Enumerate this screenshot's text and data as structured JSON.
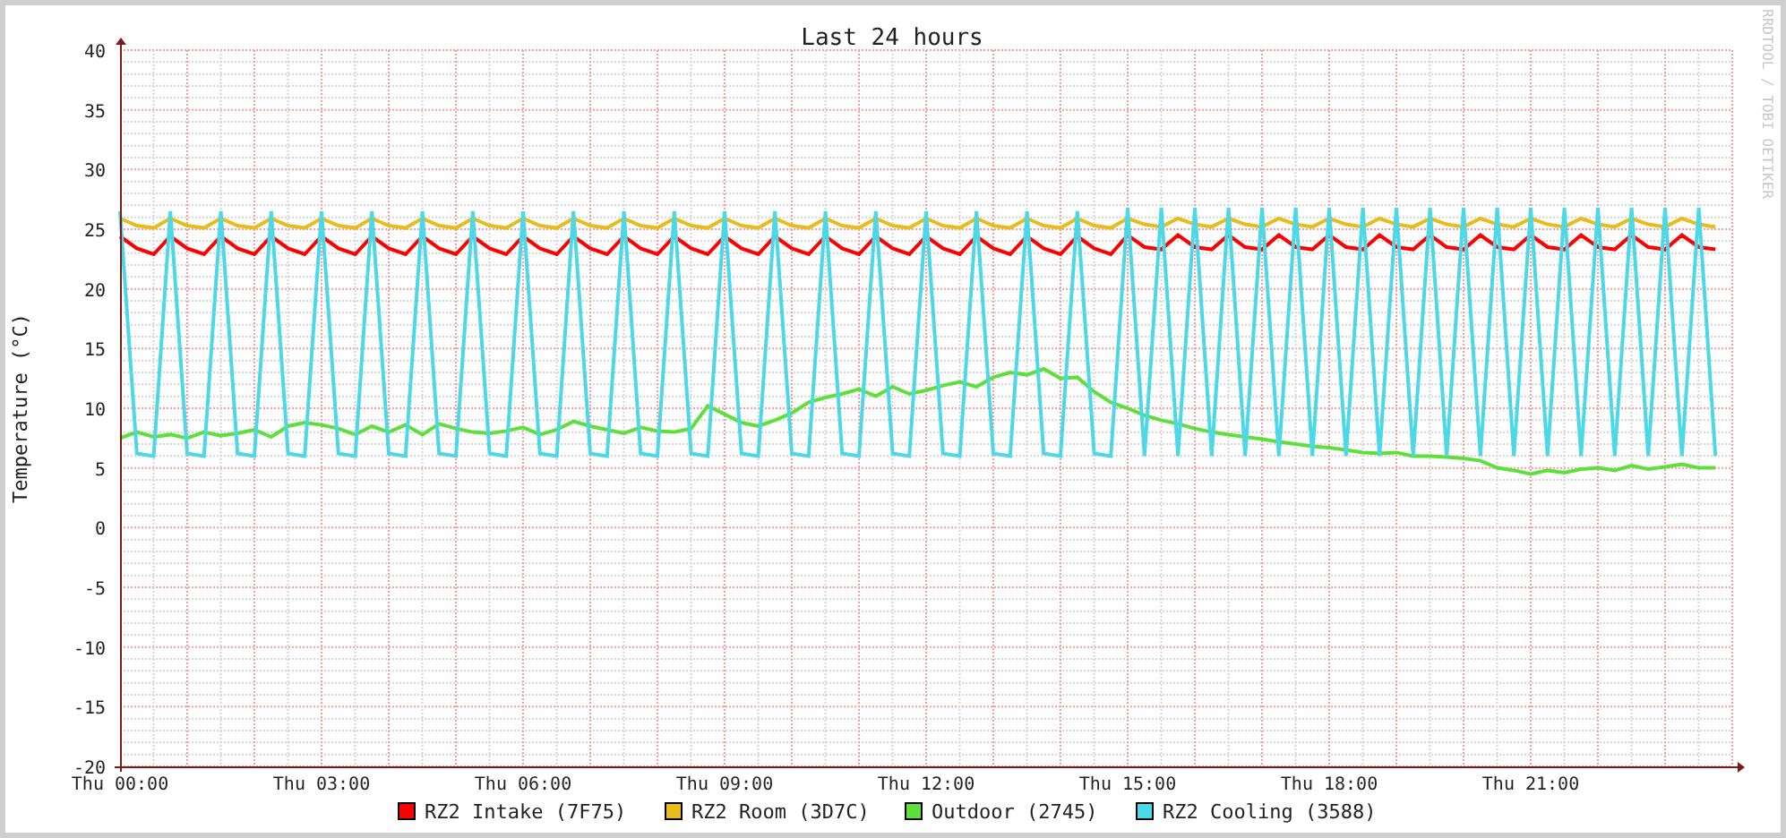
{
  "chart_data": {
    "type": "line",
    "grid": true,
    "legend": "bottom",
    "title": "Last 24 hours",
    "ylabel": "Temperature (°C)",
    "ylim": [
      -20,
      40
    ],
    "categories": [
      "Thu 00:00",
      null,
      null,
      null,
      null,
      null,
      null,
      null,
      null,
      null,
      null,
      null,
      "Thu 03:00",
      null,
      null,
      null,
      null,
      null,
      null,
      null,
      null,
      null,
      null,
      null,
      "Thu 06:00",
      null,
      null,
      null,
      null,
      null,
      null,
      null,
      null,
      null,
      null,
      null,
      "Thu 09:00",
      null,
      null,
      null,
      null,
      null,
      null,
      null,
      null,
      null,
      null,
      null,
      "Thu 12:00",
      null,
      null,
      null,
      null,
      null,
      null,
      null,
      null,
      null,
      null,
      null,
      "Thu 15:00",
      null,
      null,
      null,
      null,
      null,
      null,
      null,
      null,
      null,
      null,
      null,
      "Thu 18:00",
      null,
      null,
      null,
      null,
      null,
      null,
      null,
      null,
      null,
      null,
      null,
      "Thu 21:00",
      null,
      null,
      null,
      null,
      null,
      null,
      null,
      null,
      null,
      null,
      null
    ],
    "yticks": [
      -20,
      -15,
      -10,
      -5,
      0,
      5,
      10,
      15,
      20,
      25,
      30,
      35,
      40
    ],
    "series": [
      {
        "name": "RZ2 Intake (7F75)",
        "color": "#ff0000",
        "values": [
          24.4,
          23.4,
          22.9,
          24.4,
          23.4,
          22.9,
          24.4,
          23.4,
          22.9,
          24.4,
          23.4,
          22.9,
          24.4,
          23.4,
          22.9,
          24.4,
          23.4,
          22.9,
          24.4,
          23.4,
          22.9,
          24.4,
          23.4,
          22.9,
          24.4,
          23.4,
          22.9,
          24.4,
          23.4,
          22.9,
          24.4,
          23.4,
          22.9,
          24.4,
          23.4,
          22.9,
          24.4,
          23.4,
          22.9,
          24.4,
          23.4,
          22.9,
          24.4,
          23.4,
          22.9,
          24.4,
          23.4,
          22.9,
          24.4,
          23.4,
          22.9,
          24.4,
          23.4,
          22.9,
          24.4,
          23.4,
          22.9,
          24.4,
          23.4,
          22.9,
          24.5,
          23.5,
          23.3,
          24.5,
          23.5,
          23.3,
          24.5,
          23.5,
          23.3,
          24.5,
          23.5,
          23.3,
          24.5,
          23.5,
          23.3,
          24.5,
          23.5,
          23.3,
          24.5,
          23.5,
          23.3,
          24.5,
          23.5,
          23.3,
          24.5,
          23.5,
          23.3,
          24.5,
          23.5,
          23.3,
          24.5,
          23.5,
          23.3,
          24.5,
          23.5,
          23.3
        ]
      },
      {
        "name": "RZ2 Room (3D7C)",
        "color": "#e8bc1c",
        "values": [
          25.9,
          25.3,
          25.1,
          25.9,
          25.3,
          25.1,
          25.9,
          25.3,
          25.1,
          25.9,
          25.3,
          25.1,
          25.9,
          25.3,
          25.1,
          25.9,
          25.3,
          25.1,
          25.9,
          25.3,
          25.1,
          25.9,
          25.3,
          25.1,
          25.9,
          25.3,
          25.1,
          25.9,
          25.3,
          25.1,
          25.9,
          25.3,
          25.1,
          25.9,
          25.3,
          25.1,
          25.9,
          25.3,
          25.1,
          25.9,
          25.3,
          25.1,
          25.9,
          25.3,
          25.1,
          25.9,
          25.3,
          25.1,
          25.9,
          25.3,
          25.1,
          25.9,
          25.3,
          25.1,
          25.9,
          25.3,
          25.1,
          25.9,
          25.3,
          25.1,
          25.9,
          25.4,
          25.2,
          25.9,
          25.4,
          25.2,
          25.9,
          25.4,
          25.2,
          25.9,
          25.4,
          25.2,
          25.9,
          25.4,
          25.2,
          25.9,
          25.4,
          25.2,
          25.9,
          25.4,
          25.2,
          25.9,
          25.4,
          25.2,
          25.9,
          25.4,
          25.2,
          25.9,
          25.4,
          25.2,
          25.9,
          25.4,
          25.2,
          25.9,
          25.4,
          25.2
        ]
      },
      {
        "name": "Outdoor (2745)",
        "color": "#5ee03c",
        "values": [
          7.5,
          8.0,
          7.6,
          7.8,
          7.5,
          8.0,
          7.7,
          7.9,
          8.2,
          7.6,
          8.5,
          8.8,
          8.6,
          8.3,
          7.8,
          8.5,
          8.0,
          8.6,
          7.8,
          8.7,
          8.3,
          8.0,
          7.9,
          8.1,
          8.4,
          7.8,
          8.2,
          8.9,
          8.5,
          8.2,
          7.9,
          8.4,
          8.1,
          8.0,
          8.3,
          10.2,
          9.5,
          8.8,
          8.5,
          9.0,
          9.6,
          10.5,
          10.9,
          11.2,
          11.6,
          11.0,
          11.8,
          11.2,
          11.5,
          11.9,
          12.2,
          11.8,
          12.6,
          13.0,
          12.8,
          13.3,
          12.5,
          12.6,
          11.4,
          10.5,
          10.0,
          9.4,
          9.0,
          8.7,
          8.3,
          8.0,
          7.8,
          7.6,
          7.4,
          7.2,
          7.0,
          6.8,
          6.7,
          6.5,
          6.3,
          6.2,
          6.3,
          6.0,
          6.0,
          5.9,
          5.8,
          5.6,
          5.0,
          4.8,
          4.5,
          4.8,
          4.6,
          4.9,
          5.0,
          4.8,
          5.2,
          4.9,
          5.1,
          5.3,
          5.0,
          5.0
        ]
      },
      {
        "name": "RZ2 Cooling (3588)",
        "color": "#4dd8e8",
        "values": [
          26.5,
          6.2,
          6.0,
          26.5,
          6.2,
          6.0,
          26.5,
          6.2,
          6.0,
          26.5,
          6.2,
          6.0,
          26.5,
          6.2,
          6.0,
          26.5,
          6.2,
          6.0,
          26.5,
          6.2,
          6.0,
          26.5,
          6.2,
          6.0,
          26.5,
          6.2,
          6.0,
          26.5,
          6.2,
          6.0,
          26.5,
          6.2,
          6.0,
          26.5,
          6.2,
          6.0,
          26.5,
          6.2,
          6.0,
          26.5,
          6.2,
          6.0,
          26.5,
          6.2,
          6.0,
          26.5,
          6.2,
          6.0,
          26.5,
          6.2,
          6.0,
          26.5,
          6.2,
          6.0,
          26.5,
          6.2,
          6.0,
          26.5,
          6.2,
          6.0,
          26.8,
          6.0,
          26.8,
          6.0,
          26.8,
          6.0,
          26.8,
          6.0,
          26.8,
          6.0,
          26.8,
          6.0,
          26.8,
          6.0,
          26.8,
          6.0,
          26.8,
          6.0,
          26.8,
          6.0,
          26.8,
          6.0,
          26.8,
          6.0,
          26.8,
          6.0,
          26.8,
          6.0,
          26.8,
          6.0,
          26.8,
          6.0,
          26.8,
          6.0,
          26.8,
          6.0
        ]
      }
    ]
  },
  "credit": "RRDTOOL / TOBI OETIKER"
}
